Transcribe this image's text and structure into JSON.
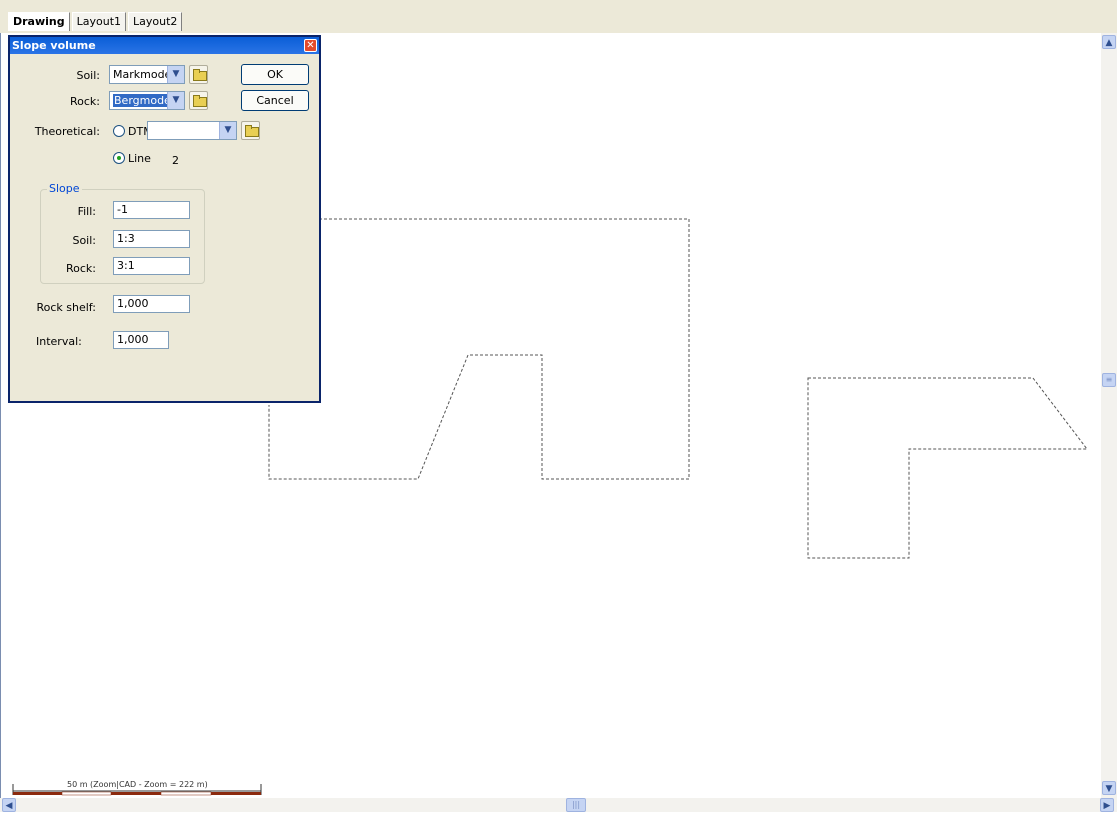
{
  "tabs": [
    {
      "label": "Drawing",
      "active": true
    },
    {
      "label": "Layout1",
      "active": false
    },
    {
      "label": "Layout2",
      "active": false
    }
  ],
  "dialog": {
    "title": "Slope volume",
    "soil_label": "Soil:",
    "soil_value": "Markmode",
    "rock_label": "Rock:",
    "rock_value": "Bergmode",
    "ok_label": "OK",
    "cancel_label": "Cancel",
    "theoretical_label": "Theoretical:",
    "dtm_label": "DTM",
    "dtm_value": "",
    "line_label": "Line",
    "line_value": "2",
    "line_selected": true,
    "slope_group": {
      "title": "Slope",
      "fill_label": "Fill:",
      "fill_value": "-1",
      "soil_label": "Soil:",
      "soil_value": "1:3",
      "rock_label": "Rock:",
      "rock_value": "3:1"
    },
    "rock_shelf_label": "Rock shelf:",
    "rock_shelf_value": "1,000",
    "interval_label": "Interval:",
    "interval_value": "1,000"
  },
  "scale_bar": {
    "label": "50 m  (Zoom|CAD - Zoom = 222 m)"
  },
  "colors": {
    "title_bar": "#0a5ed7",
    "dialog_bg": "#ece9d8",
    "scale_dark": "#8b2a0e",
    "outline": "#555555"
  }
}
